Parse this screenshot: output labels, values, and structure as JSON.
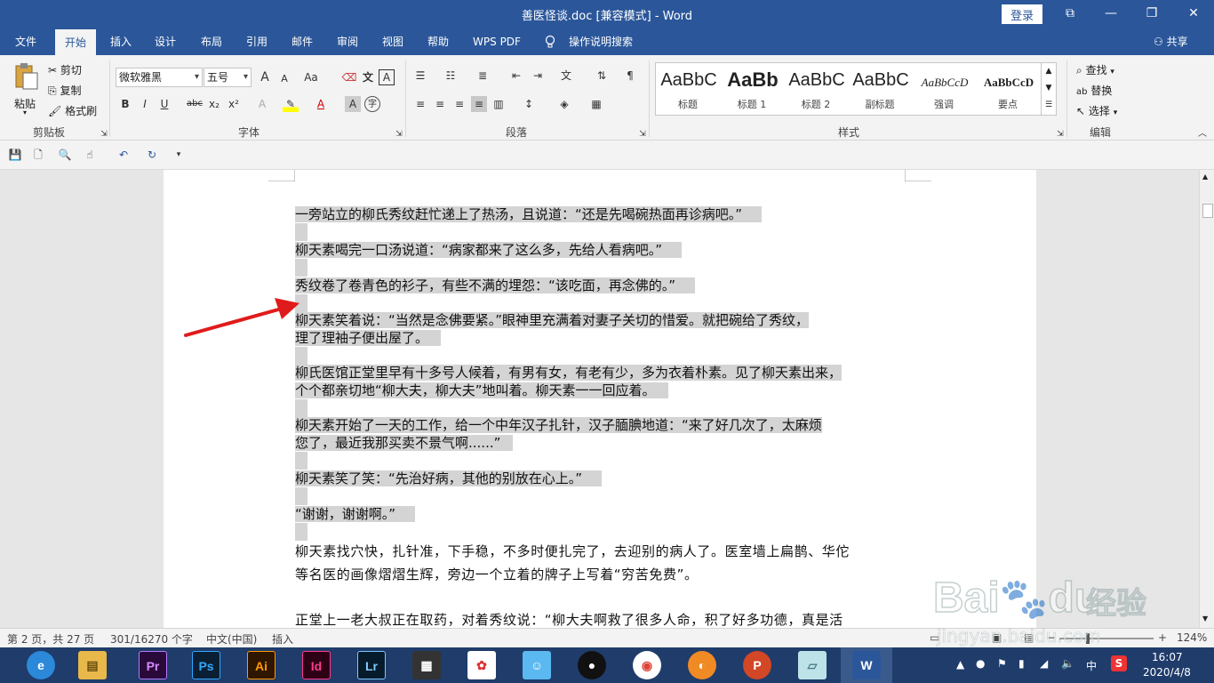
{
  "window": {
    "title": "善医怪谈.doc [兼容模式]  -  Word",
    "login": "登录",
    "controls": [
      "⧉",
      "—",
      "❐",
      "✕"
    ]
  },
  "tabs": [
    "文件",
    "开始",
    "插入",
    "设计",
    "布局",
    "引用",
    "邮件",
    "审阅",
    "视图",
    "帮助",
    "WPS PDF",
    "操作说明搜索"
  ],
  "share": "共享",
  "ribbon": {
    "clipboard": {
      "paste": "粘贴",
      "cut": "剪切",
      "copy": "复制",
      "format_painter": "格式刷",
      "label": "剪贴板"
    },
    "font": {
      "name": "微软雅黑",
      "size": "五号",
      "label": "字体",
      "grow": "A",
      "shrink": "A",
      "case": "Aa",
      "bold": "B",
      "italic": "I",
      "underline": "U",
      "strike": "abc",
      "sub": "x₂",
      "sup": "x²",
      "box": "A",
      "shade": "A",
      "circle": "字"
    },
    "paragraph": {
      "label": "段落"
    },
    "styles": {
      "label": "样式",
      "items": [
        {
          "preview": "AaBbC",
          "name": "标题"
        },
        {
          "preview": "AaBb",
          "name": "标题 1"
        },
        {
          "preview": "AaBbC",
          "name": "标题 2"
        },
        {
          "preview": "AaBbC",
          "name": "副标题"
        },
        {
          "preview": "AaBbCcD",
          "name": "强调"
        },
        {
          "preview": "AaBbCcD",
          "name": "要点"
        }
      ]
    },
    "editing": {
      "find": "查找",
      "replace": "替换",
      "select": "选择",
      "label": "编辑"
    }
  },
  "document": {
    "highlighted": [
      [
        "一旁站立的柳氏秀纹赶忙递上了热汤，且说道：“还是先喝碗热面再诊病吧。”"
      ],
      [
        "柳天素喝完一口汤说道：“病家都来了这么多，先给人看病吧。”"
      ],
      [
        "秀纹卷了卷青色的衫子，有些不满的埋怨：“该吃面，再念佛的。”"
      ],
      [
        "柳天素笑着说：“当然是念佛要紧。”眼神里充满着对妻子关切的惜爱。就把碗给了秀纹，",
        "理了理袖子便出屋了。"
      ],
      [
        "柳氏医馆正堂里早有十多号人候着，有男有女，有老有少，多为衣着朴素。见了柳天素出来，",
        "个个都亲切地“柳大夫，柳大夫”地叫着。柳天素一一回应着。"
      ],
      [
        "柳天素开始了一天的工作，给一个中年汉子扎针，汉子腼腆地道：“来了好几次了，太麻烦",
        "您了，最近我那买卖不景气啊......”"
      ],
      [
        "柳天素笑了笑：“先治好病，其他的别放在心上。”"
      ],
      [
        "“谢谢，谢谢啊。”"
      ]
    ],
    "plain": [
      "柳天素找穴快，扎针准，下手稳，不多时便扎完了，去迎别的病人了。医室墙上扁鹊、华佗",
      "等名医的画像熠熠生辉，旁边一个立着的牌子上写着“穷苦免费”。"
    ],
    "last_line": "正堂上一老大叔正在取药，对着秀纹说：“柳大夫啊救了很多人命，积了好多功德，真是活"
  },
  "statusbar": {
    "page": "第 2 页，共 27 页",
    "words": "301/16270 个字",
    "lang": "中文(中国)",
    "mode": "插入",
    "zoom": "124%",
    "minus": "−",
    "plus": "+"
  },
  "taskbar": {
    "apps": [
      {
        "name": "browser",
        "label": "e"
      },
      {
        "name": "explorer",
        "label": "▤"
      },
      {
        "name": "premiere",
        "label": "Pr"
      },
      {
        "name": "photoshop",
        "label": "Ps"
      },
      {
        "name": "illustrator",
        "label": "Ai"
      },
      {
        "name": "indesign",
        "label": "Id"
      },
      {
        "name": "lightroom",
        "label": "Lr"
      },
      {
        "name": "video",
        "label": "▦"
      },
      {
        "name": "pinwheel",
        "label": "✿"
      },
      {
        "name": "chat",
        "label": "☺"
      },
      {
        "name": "qq",
        "label": "●"
      },
      {
        "name": "chrome",
        "label": "◉"
      },
      {
        "name": "fox",
        "label": "◐"
      },
      {
        "name": "powerpoint",
        "label": "P"
      },
      {
        "name": "notes",
        "label": "▱"
      },
      {
        "name": "word",
        "label": "W"
      }
    ],
    "ime": "中",
    "time": "16:07",
    "date": "2020/4/8"
  },
  "watermark": {
    "brand": "Bai",
    "brand2": "du",
    "jingyan": "经验",
    "url": "jingyan.baidu.com"
  },
  "colors": {
    "word_blue": "#2b579a",
    "selection": "#d4d4d4",
    "arrow": "#e01b1b"
  }
}
